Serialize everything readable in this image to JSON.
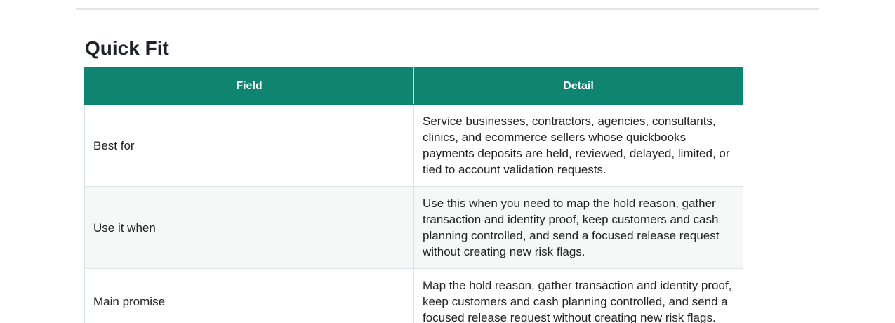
{
  "section": {
    "title": "Quick Fit"
  },
  "table": {
    "headers": [
      "Field",
      "Detail"
    ],
    "rows": [
      {
        "field": "Best for",
        "detail": "Service businesses, contractors, agencies, consultants, clinics, and ecommerce sellers whose quickbooks payments deposits are held, reviewed, delayed, limited, or tied to account validation requests."
      },
      {
        "field": "Use it when",
        "detail": "Use this when you need to map the hold reason, gather transaction and identity proof, keep customers and cash planning controlled, and send a focused release request without creating new risk flags."
      },
      {
        "field": "Main promise",
        "detail": "Map the hold reason, gather transaction and identity proof, keep customers and cash planning controlled, and send a focused release request without creating new risk flags."
      }
    ]
  },
  "colors": {
    "header_bg": "#0e8471",
    "header_text": "#ffffff",
    "alt_row_bg": "#f6f8f7"
  }
}
